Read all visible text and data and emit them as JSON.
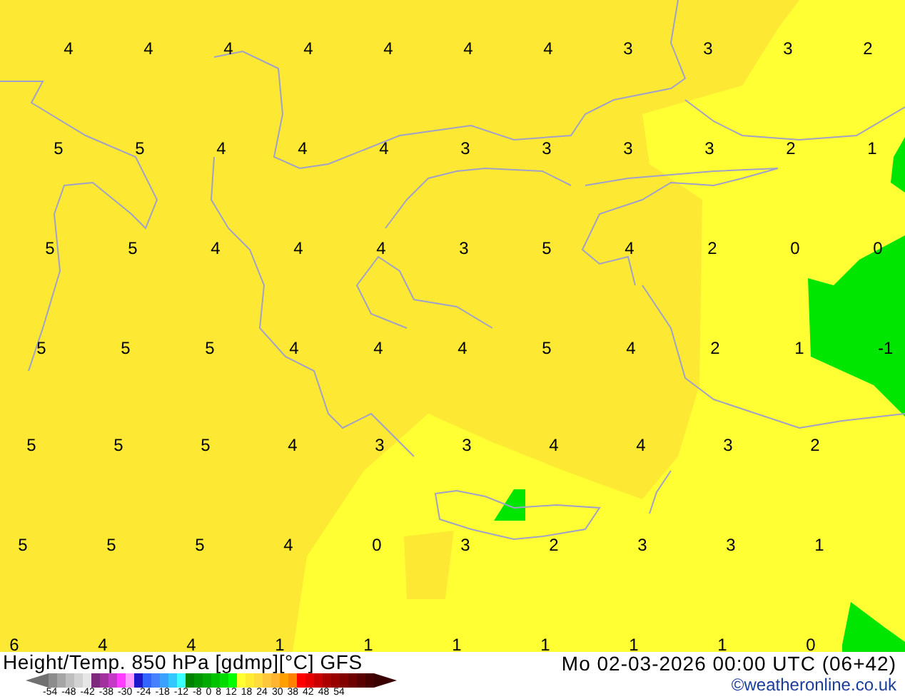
{
  "map": {
    "label_rows": [
      [
        "4",
        "4",
        "4",
        "4",
        "4",
        "4",
        "4",
        "3",
        "3",
        "3",
        "2"
      ],
      [
        "5",
        "5",
        "4",
        "4",
        "4",
        "3",
        "3",
        "3",
        "3",
        "2",
        "1"
      ],
      [
        "5",
        "5",
        "4",
        "4",
        "4",
        "3",
        "5",
        "4",
        "2",
        "0",
        "0"
      ],
      [
        "5",
        "5",
        "5",
        "4",
        "4",
        "4",
        "5",
        "4",
        "2",
        "1",
        "-1"
      ],
      [
        "5",
        "5",
        "5",
        "4",
        "3",
        "3",
        "4",
        "4",
        "3",
        "2"
      ],
      [
        "5",
        "5",
        "5",
        "4",
        "0",
        "3",
        "2",
        "3",
        "3",
        "1"
      ],
      [
        "6",
        "4",
        "4",
        "1",
        "1",
        "1",
        "1",
        "1",
        "1",
        "0"
      ]
    ]
  },
  "footer": {
    "title": "Height/Temp. 850 hPa [gdmp][°C] GFS",
    "datetime": "Mo 02-03-2026 00:00 UTC (06+42)",
    "credit": "©weatheronline.co.uk",
    "scale": {
      "swatches": [
        {
          "color": "#8c8c8c"
        },
        {
          "color": "#a5a5a5"
        },
        {
          "color": "#bebebe"
        },
        {
          "color": "#d2d2d2"
        },
        {
          "color": "#e6e6e6"
        },
        {
          "color": "#7d2a7d"
        },
        {
          "color": "#a0319f"
        },
        {
          "color": "#c43ac4"
        },
        {
          "color": "#ff3cff"
        },
        {
          "color": "#ff9cff"
        },
        {
          "color": "#1e14c8"
        },
        {
          "color": "#3264ff"
        },
        {
          "color": "#4682ff"
        },
        {
          "color": "#3ca0ff"
        },
        {
          "color": "#32c8ff"
        },
        {
          "color": "#3cffff"
        },
        {
          "color": "#008200"
        },
        {
          "color": "#009600"
        },
        {
          "color": "#00aa00"
        },
        {
          "color": "#00c300"
        },
        {
          "color": "#00dc00"
        },
        {
          "color": "#00ff00"
        },
        {
          "color": "#ffff32"
        },
        {
          "color": "#ffeb32"
        },
        {
          "color": "#ffdc3c"
        },
        {
          "color": "#ffc83c"
        },
        {
          "color": "#ffb432"
        },
        {
          "color": "#ffa000"
        },
        {
          "color": "#ff8200"
        },
        {
          "color": "#ff0000"
        },
        {
          "color": "#e60000"
        },
        {
          "color": "#c80000"
        },
        {
          "color": "#aa0000"
        },
        {
          "color": "#960000"
        },
        {
          "color": "#820000"
        },
        {
          "color": "#6e0000"
        },
        {
          "color": "#5a0000"
        },
        {
          "color": "#460000"
        }
      ],
      "ticks": [
        "-54",
        "-48",
        "-42",
        "-38",
        "-30",
        "-24",
        "-18",
        "-12",
        "-8",
        "0",
        "8",
        "12",
        "18",
        "24",
        "30",
        "38",
        "42",
        "48",
        "54"
      ]
    }
  }
}
